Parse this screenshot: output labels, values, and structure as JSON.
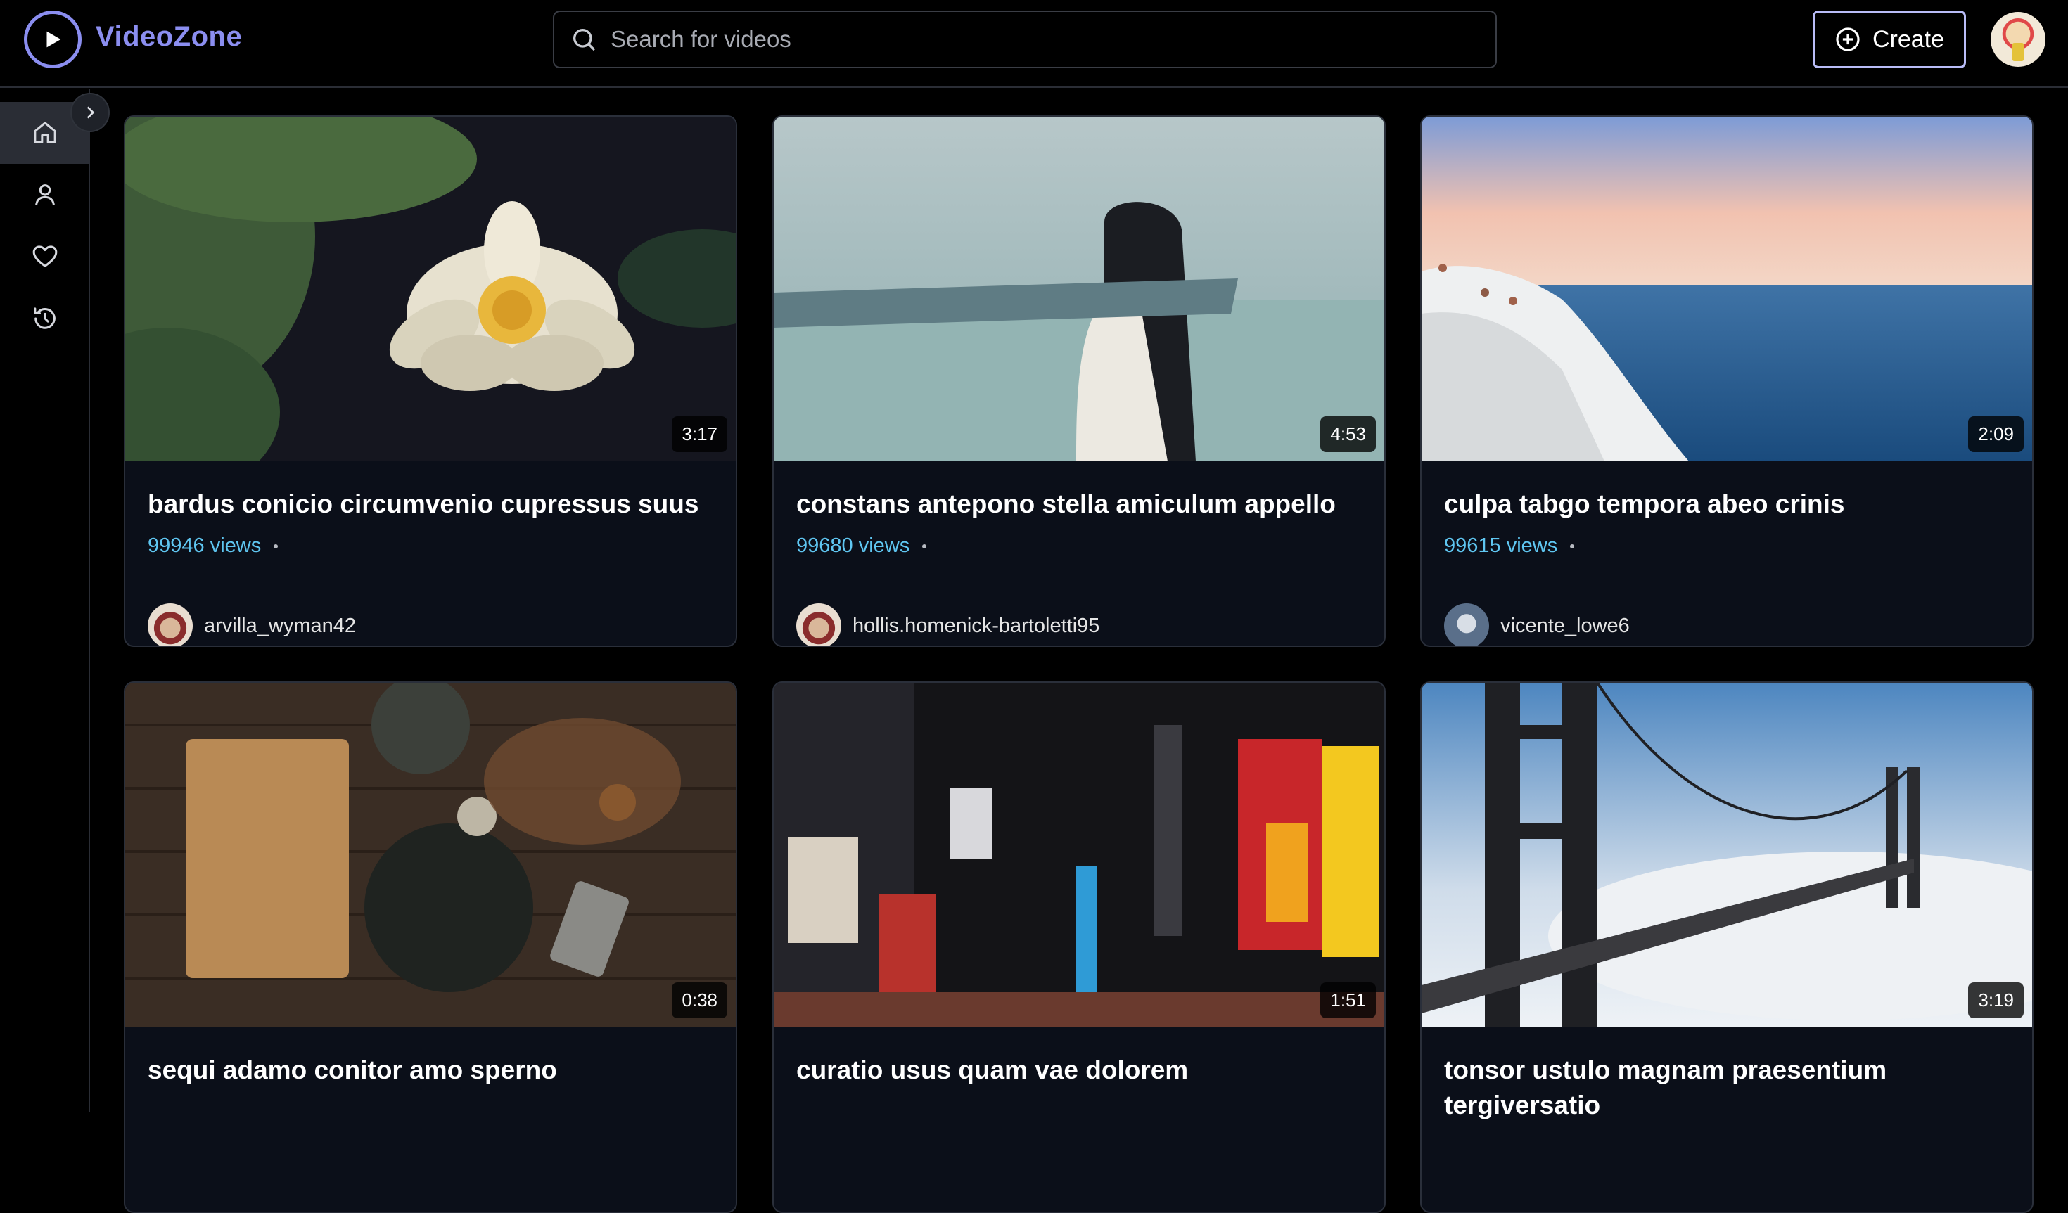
{
  "app": {
    "name": "VideoZone"
  },
  "search": {
    "placeholder": "Search for videos",
    "value": ""
  },
  "header": {
    "create_label": "Create"
  },
  "sidebar": {
    "items": [
      {
        "name": "home",
        "icon": "home-icon",
        "active": true
      },
      {
        "name": "profile",
        "icon": "user-icon",
        "active": false
      },
      {
        "name": "liked",
        "icon": "heart-icon",
        "active": false
      },
      {
        "name": "history",
        "icon": "history-icon",
        "active": false
      }
    ]
  },
  "theme": {
    "accent": "#8b8ef0",
    "views_color": "#5fc6f1",
    "card_bg": "#0b0f19"
  },
  "videos": [
    {
      "title": "bardus conicio circumvenio cupressus suus",
      "views": "99946 views",
      "duration": "3:17",
      "channel": "arvilla_wyman42",
      "thumbnail": "water-lily"
    },
    {
      "title": "constans antepono stella amiculum appello",
      "views": "99680 views",
      "duration": "4:53",
      "channel": "hollis.homenick-bartoletti95",
      "thumbnail": "blindfolded-woman-sea"
    },
    {
      "title": "culpa tabgo tempora abeo crinis",
      "views": "99615 views",
      "duration": "2:09",
      "channel": "vicente_lowe6",
      "thumbnail": "cliff-over-sea"
    },
    {
      "title": "sequi adamo conitor amo sperno",
      "views": "",
      "duration": "0:38",
      "channel": "",
      "thumbnail": "kitchen-table"
    },
    {
      "title": "curatio usus quam vae dolorem",
      "views": "",
      "duration": "1:51",
      "channel": "",
      "thumbnail": "times-square-night"
    },
    {
      "title": "tonsor ustulo magnam praesentium tergiversatio",
      "views": "",
      "duration": "3:19",
      "channel": "",
      "thumbnail": "golden-gate-fog"
    }
  ]
}
